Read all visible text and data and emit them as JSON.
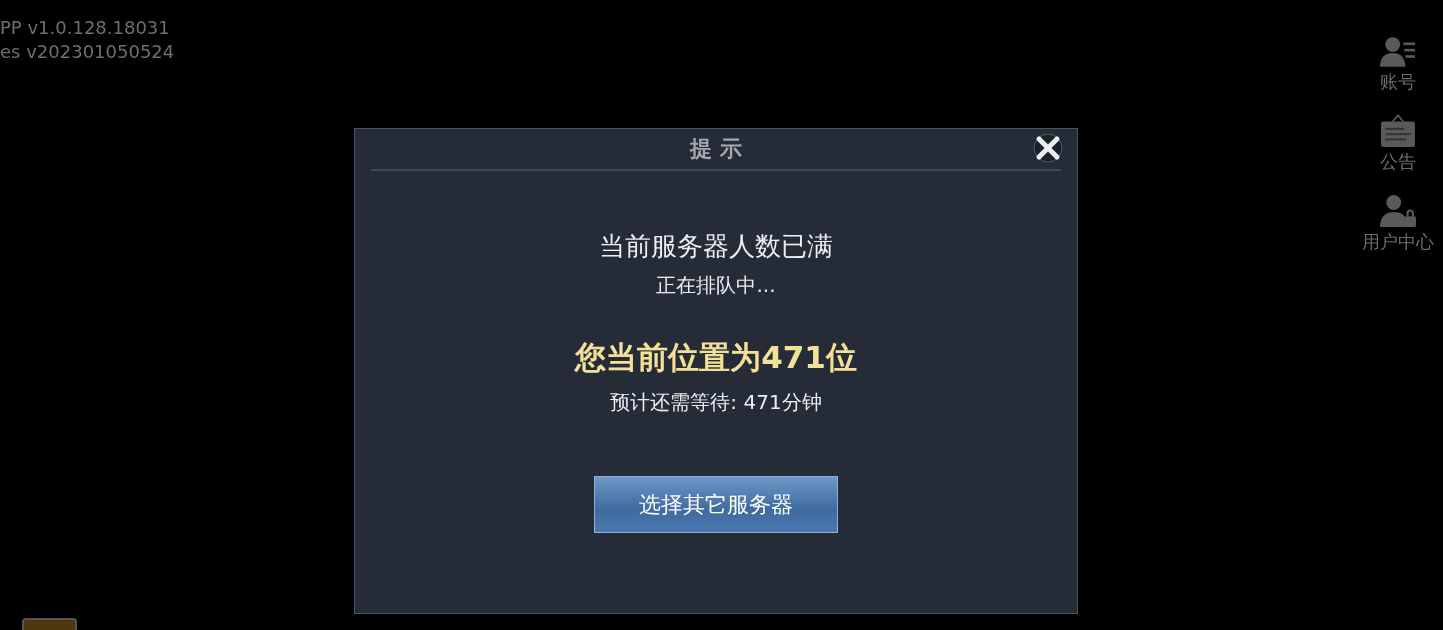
{
  "version_info": [
    "PP v1.0.128.18031",
    "es v202301050524"
  ],
  "side_menu": [
    {
      "label": "账号",
      "kind": "account"
    },
    {
      "label": "公告",
      "kind": "notice"
    },
    {
      "label": "用户中心",
      "kind": "user_center"
    }
  ],
  "dialog": {
    "title": "提 示",
    "status": "当前服务器人数已满",
    "queue_note": "正在排队中...",
    "position": "您当前位置为471位",
    "wait": "预计还需等待: 471分钟",
    "button": "选择其它服务器"
  }
}
